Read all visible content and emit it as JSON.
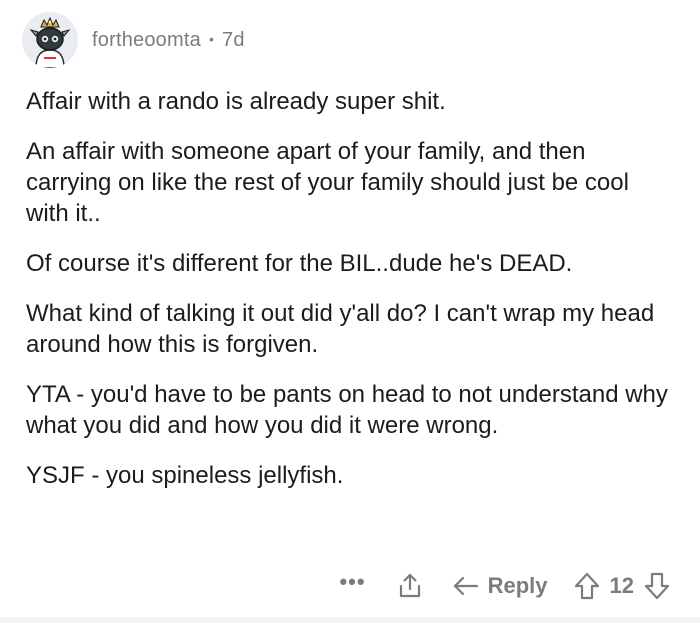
{
  "comment": {
    "author": "fortheoomta",
    "separator": "•",
    "age": "7d",
    "paragraphs": [
      "Affair with a rando is already super shit.",
      "An affair with someone apart of your family, and then carrying on like the rest of your family should just be cool with it..",
      "Of course it's different for the BIL..dude he's DEAD.",
      "What kind of talking it out did y'all do? I can't wrap my head around how this is forgiven.",
      "YTA - you'd have to be pants on head to not understand why what you did and how you did it were wrong.",
      "YSJF - you spineless jellyfish."
    ]
  },
  "actions": {
    "more_label": "•••",
    "reply_label": "Reply",
    "vote_count": "12"
  },
  "icons": {
    "avatar": "snoo-avatar-icon",
    "more": "more-options-icon",
    "share": "share-icon",
    "reply": "reply-arrow-icon",
    "upvote": "upvote-arrow-icon",
    "downvote": "downvote-arrow-icon"
  },
  "colors": {
    "text": "#1c1c1c",
    "muted": "#7c7c7c",
    "background": "#ffffff"
  }
}
